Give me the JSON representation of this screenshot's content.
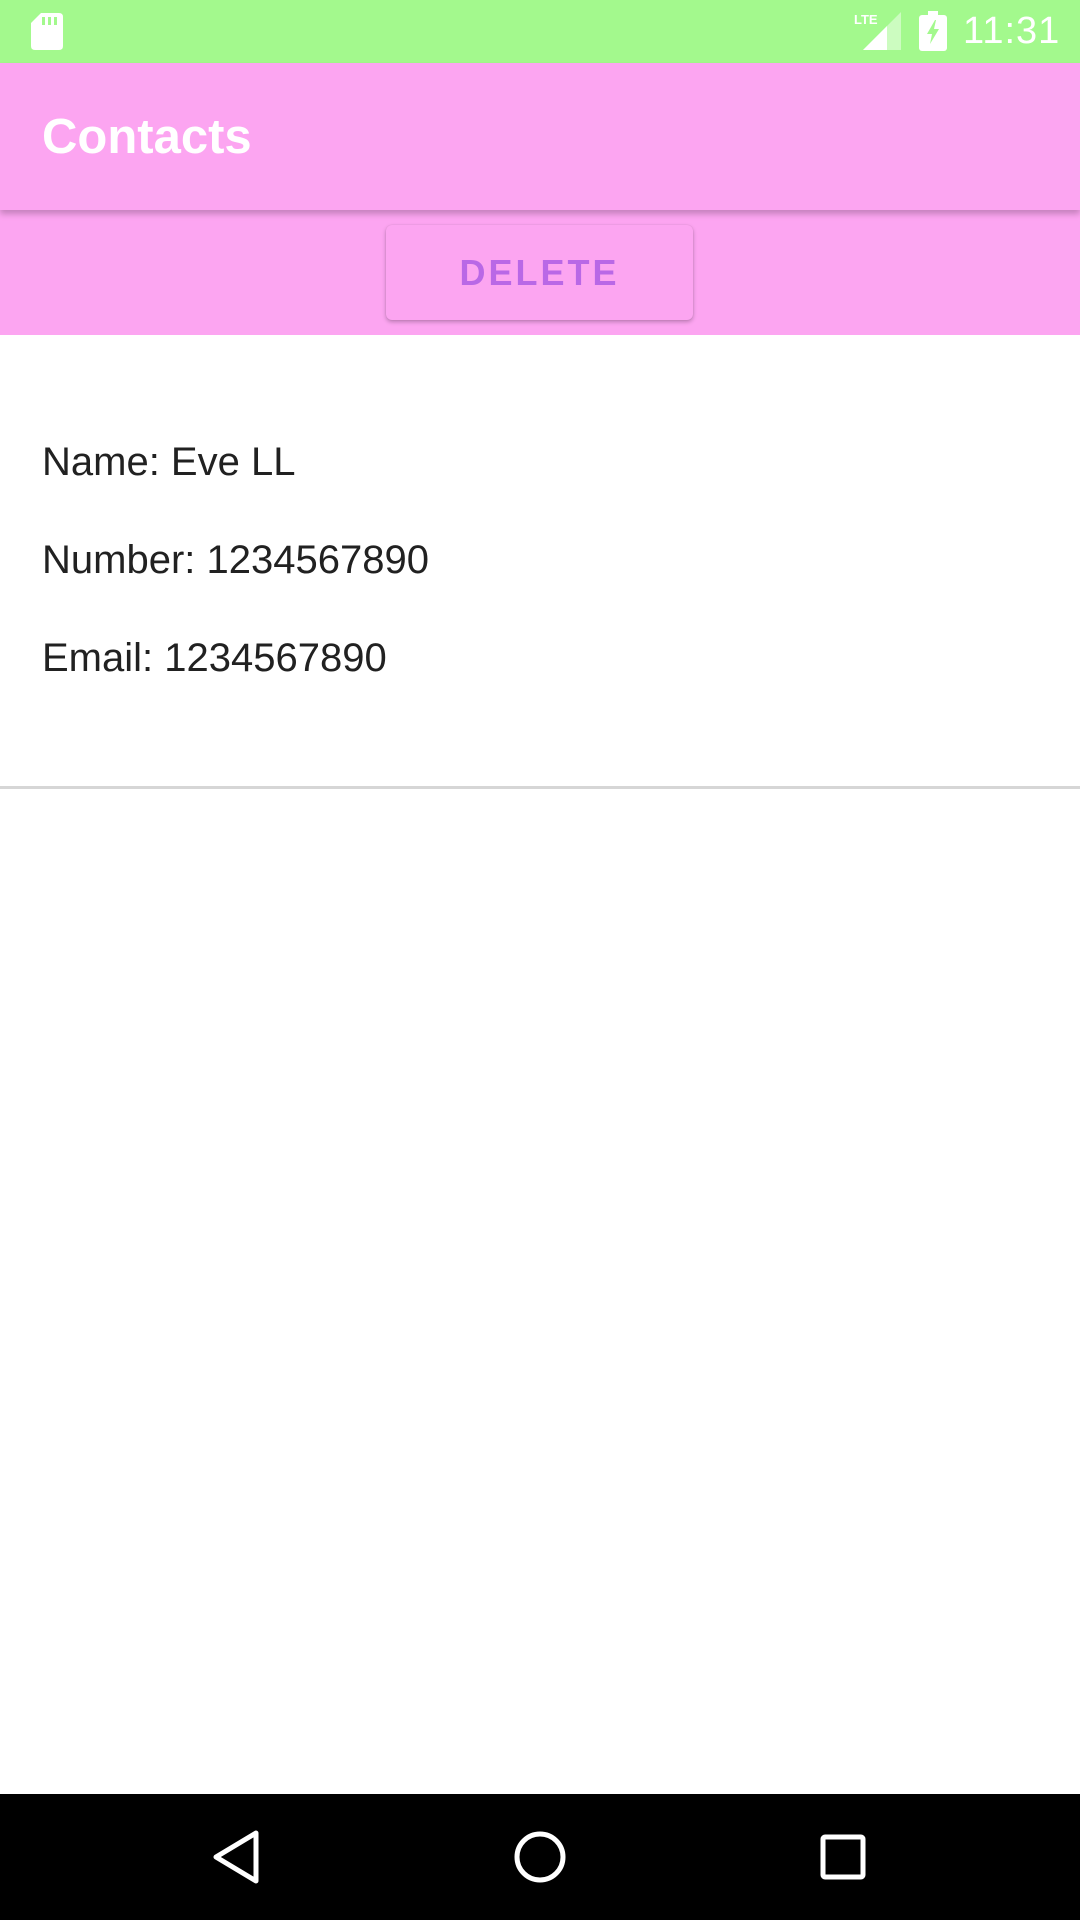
{
  "status_bar": {
    "time": "11:31",
    "network_label": "LTE",
    "icons": [
      "sd-card-icon",
      "signal-icon",
      "battery-charging-icon"
    ]
  },
  "app_bar": {
    "title": "Contacts"
  },
  "actions": {
    "delete_label": "DELETE"
  },
  "contact": {
    "name_line": "Name: Eve LL",
    "number_line": "Number: 1234567890",
    "email_line": "Email: 1234567890"
  },
  "nav_bar": {
    "icons": [
      "back-icon",
      "home-icon",
      "recents-icon"
    ]
  },
  "colors": {
    "status_bar": "#a3f98d",
    "app_bar": "#fca5f1",
    "accent_text": "#b968e6",
    "body_text": "#212121"
  }
}
